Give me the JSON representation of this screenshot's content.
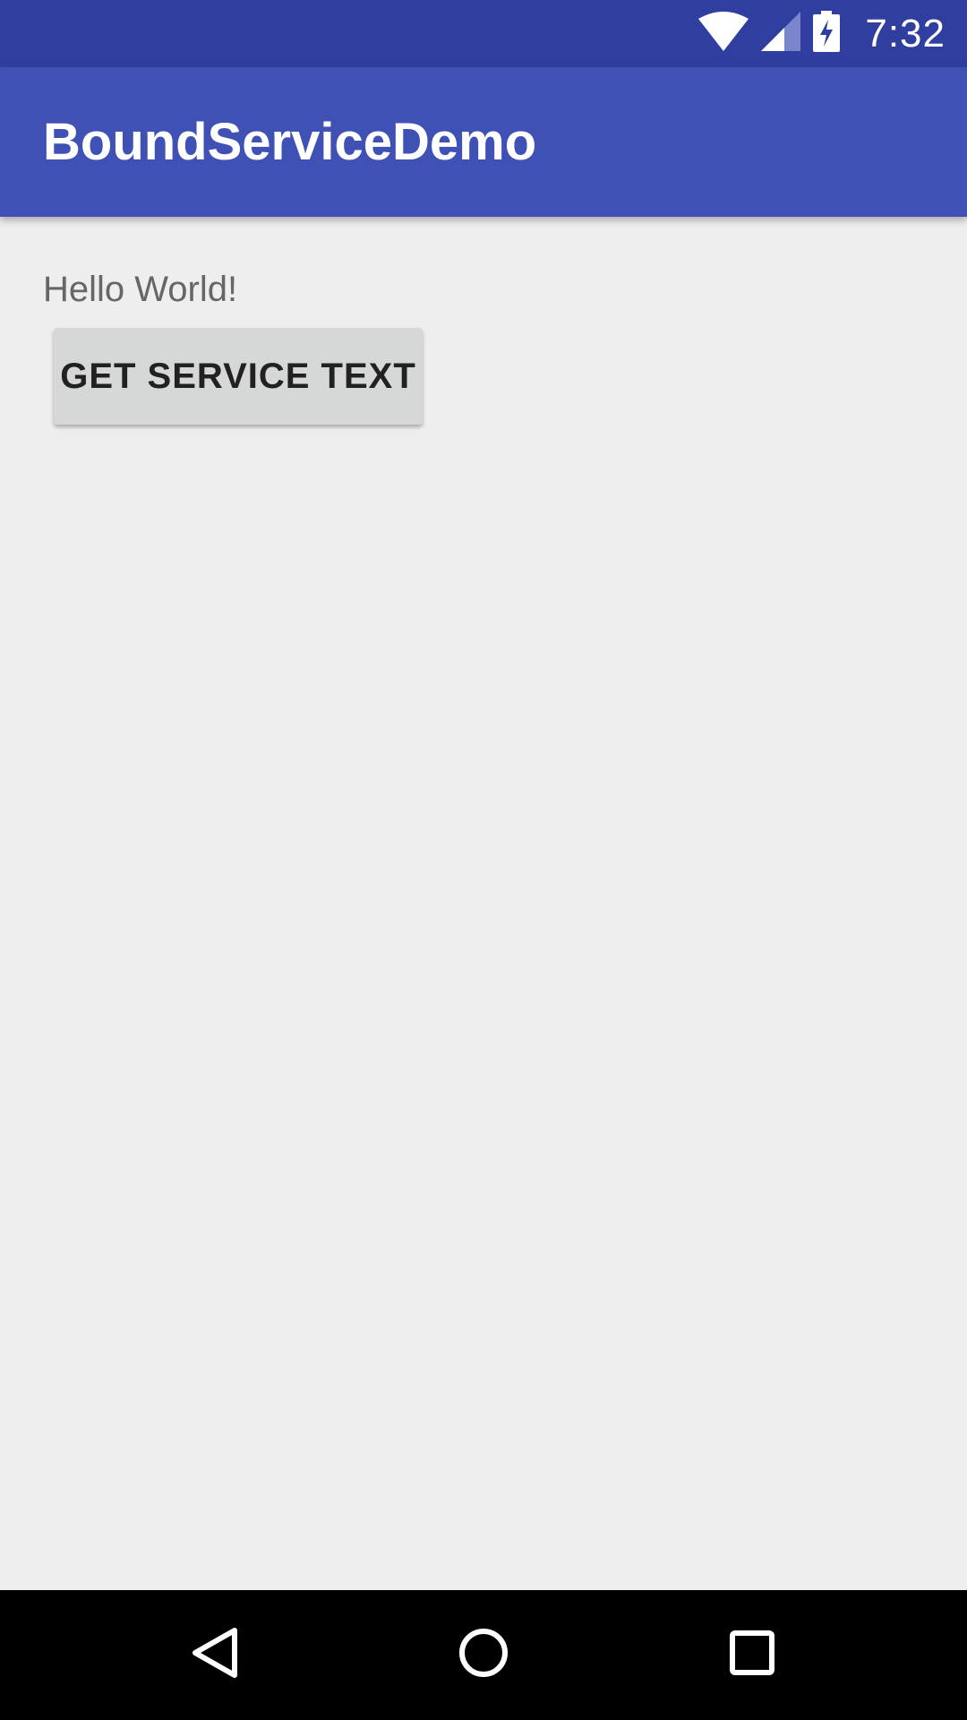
{
  "status_bar": {
    "time": "7:32",
    "icons": [
      "wifi-icon",
      "cell-signal-icon",
      "battery-charging-icon"
    ]
  },
  "app_bar": {
    "title": "BoundServiceDemo"
  },
  "main": {
    "hello_text": "Hello World!",
    "button_label": "GET SERVICE TEXT"
  },
  "nav_bar": {
    "buttons": [
      "back-icon",
      "home-icon",
      "recents-icon"
    ]
  },
  "colors": {
    "status_bar": "#303f9f",
    "app_bar": "#3f51b5",
    "background": "#eeeeee",
    "button": "#d6d7d7",
    "nav_bar": "#000000"
  }
}
